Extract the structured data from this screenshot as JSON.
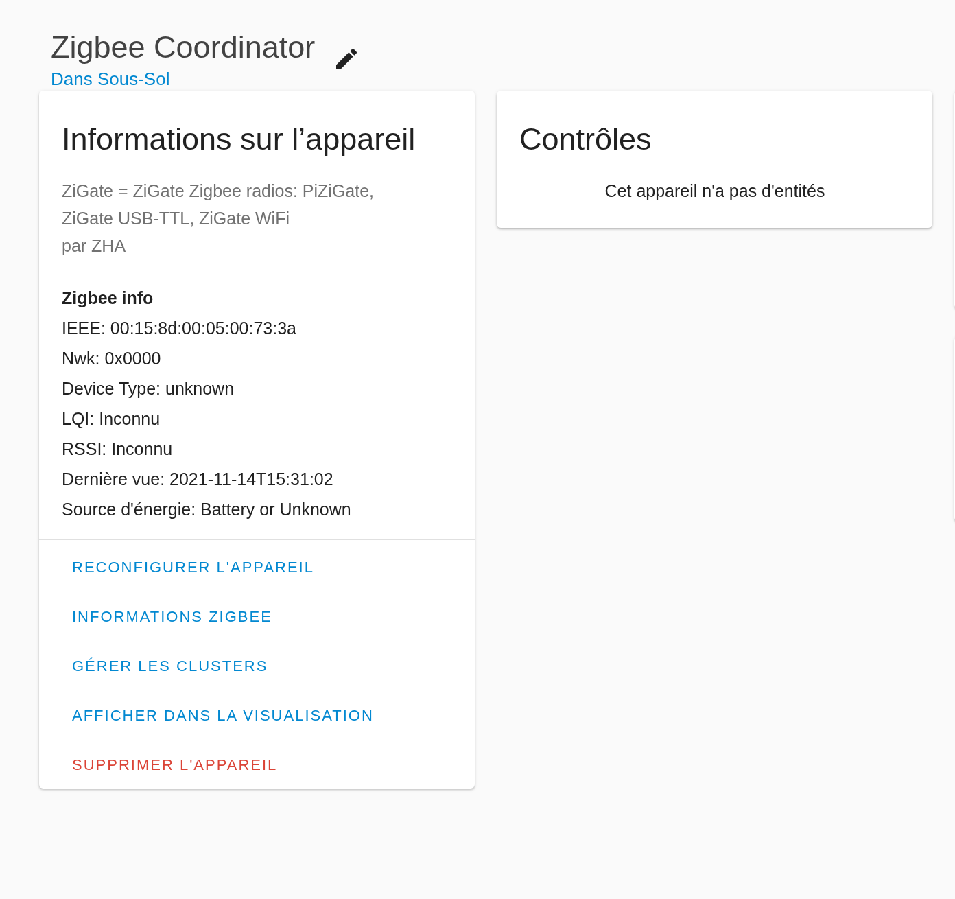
{
  "header": {
    "title": "Zigbee Coordinator",
    "area_link": "Dans Sous-Sol"
  },
  "device_info_card": {
    "title": "Informations sur l’appareil",
    "model_lines": [
      "ZiGate = ZiGate Zigbee radios: PiZiGate,",
      "ZiGate USB-TTL, ZiGate WiFi"
    ],
    "manufacturer": "par ZHA",
    "zigbee_info": {
      "heading": "Zigbee info",
      "lines": [
        "IEEE: 00:15:8d:00:05:00:73:3a",
        "Nwk: 0x0000",
        "Device Type: unknown",
        "LQI: Inconnu",
        "RSSI: Inconnu",
        "Dernière vue: 2021-11-14T15:31:02",
        "Source d'énergie: Battery or Unknown"
      ]
    },
    "actions": [
      {
        "label": "RECONFIGURER L'APPAREIL",
        "kind": "normal"
      },
      {
        "label": "INFORMATIONS ZIGBEE",
        "kind": "normal"
      },
      {
        "label": "GÉRER LES CLUSTERS",
        "kind": "normal"
      },
      {
        "label": "AFFICHER DANS LA VISUALISATION",
        "kind": "normal"
      },
      {
        "label": "SUPPRIMER L'APPAREIL",
        "kind": "danger"
      }
    ]
  },
  "controls_card": {
    "title": "Contrôles",
    "empty_message": "Cet appareil n'a pas d'entités"
  }
}
